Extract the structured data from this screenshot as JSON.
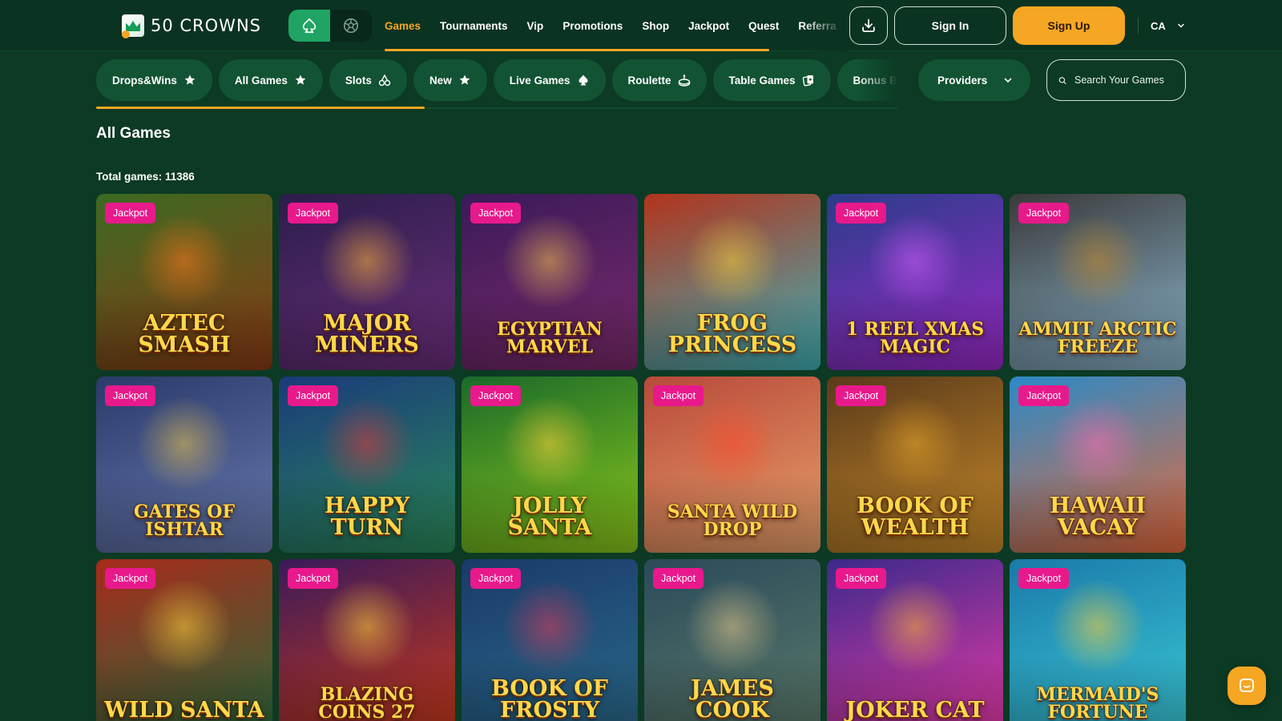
{
  "header": {
    "logo_text": "50 CROWNS",
    "nav": [
      {
        "label": "Games",
        "active": true
      },
      {
        "label": "Tournaments",
        "active": false
      },
      {
        "label": "Vip",
        "active": false
      },
      {
        "label": "Promotions",
        "active": false
      },
      {
        "label": "Shop",
        "active": false
      },
      {
        "label": "Jackpot",
        "active": false
      },
      {
        "label": "Quest",
        "active": false
      },
      {
        "label": "Referra",
        "active": false
      }
    ],
    "signin_label": "Sign In",
    "signup_label": "Sign Up",
    "language": "CA",
    "icons": {
      "casino_mode": "spade-icon",
      "sports_mode": "soccer-ball-icon",
      "download": "download-icon",
      "lang_caret": "chevron-down-icon"
    }
  },
  "categories": {
    "items": [
      {
        "label": "Drops&Wins",
        "icon": "star-icon"
      },
      {
        "label": "All Games",
        "icon": "star-icon"
      },
      {
        "label": "Slots",
        "icon": "cherries-icon"
      },
      {
        "label": "New",
        "icon": "star-icon"
      },
      {
        "label": "Live Games",
        "icon": "spade-icon"
      },
      {
        "label": "Roulette",
        "icon": "roulette-icon"
      },
      {
        "label": "Table Games",
        "icon": "cards-icon"
      },
      {
        "label": "Bonus Buy",
        "icon": ""
      }
    ],
    "providers_label": "Providers",
    "search_placeholder": "Search Your Games"
  },
  "content": {
    "section_title": "All Games",
    "total_games": "Total games: 11386",
    "badge_label": "Jackpot",
    "games": [
      {
        "title": "Aztec Smash",
        "badge": true,
        "bg": [
          "#3c6a22",
          "#8a3b14"
        ],
        "accent": "#ff7a1a"
      },
      {
        "title": "Major Miners",
        "badge": true,
        "bg": [
          "#2b1d4a",
          "#6b2f7a"
        ],
        "accent": "#ffb43a"
      },
      {
        "title": "Egyptian Marvel",
        "badge": true,
        "bg": [
          "#3a1a5a",
          "#7a2a6a"
        ],
        "accent": "#f2c14e"
      },
      {
        "title": "Frog Princess",
        "badge": false,
        "bg": [
          "#b2341c",
          "#3fb2b8"
        ],
        "accent": "#f7d03a"
      },
      {
        "title": "1 Reel Xmas Magic",
        "badge": true,
        "bg": [
          "#2a3c8a",
          "#9a2ac8"
        ],
        "accent": "#d25cff"
      },
      {
        "title": "Ammit Arctic Freeze",
        "badge": true,
        "bg": [
          "#3a3a3a",
          "#8ab4cc"
        ],
        "accent": "#c88a2a"
      },
      {
        "title": "Gates of Ishtar",
        "badge": true,
        "bg": [
          "#2a3a6a",
          "#6a7ab0"
        ],
        "accent": "#e8c24a"
      },
      {
        "title": "Happy Turn",
        "badge": true,
        "bg": [
          "#1a3a7a",
          "#2a8a5a"
        ],
        "accent": "#e03a3a"
      },
      {
        "title": "Jolly Santa",
        "badge": true,
        "bg": [
          "#1a6a2a",
          "#8ac81a"
        ],
        "accent": "#ffd23a"
      },
      {
        "title": "Santa Wild Drop",
        "badge": true,
        "bg": [
          "#b84a3a",
          "#e8a06a"
        ],
        "accent": "#ff4a2a"
      },
      {
        "title": "Book of Wealth",
        "badge": true,
        "bg": [
          "#5a3a1a",
          "#c88a2a"
        ],
        "accent": "#e8a62a"
      },
      {
        "title": "Hawaii Vacay",
        "badge": true,
        "bg": [
          "#2a8ac8",
          "#e86a3a"
        ],
        "accent": "#ff6ab0"
      },
      {
        "title": "Wild Santa",
        "badge": true,
        "bg": [
          "#a82a1a",
          "#2a6a3a"
        ],
        "accent": "#ffd23a"
      },
      {
        "title": "Blazing Coins 27",
        "badge": true,
        "bg": [
          "#3a1a5a",
          "#c8381a"
        ],
        "accent": "#ffd23a"
      },
      {
        "title": "Book of Frosty",
        "badge": true,
        "bg": [
          "#1a3a6a",
          "#2a6a8a"
        ],
        "accent": "#e03a5a"
      },
      {
        "title": "James Cook",
        "badge": true,
        "bg": [
          "#2a4a5a",
          "#5a7a6a"
        ],
        "accent": "#e8c88a"
      },
      {
        "title": "Joker Cat",
        "badge": true,
        "bg": [
          "#3a2a8a",
          "#e83aa8"
        ],
        "accent": "#ffb43a"
      },
      {
        "title": "Mermaid's Fortune",
        "badge": true,
        "bg": [
          "#1a7aa8",
          "#3ac8d8"
        ],
        "accent": "#ffd23a"
      }
    ]
  },
  "chat": {
    "icon": "chat-icon"
  },
  "colors": {
    "background": "#0c3a24",
    "header": "#0b3321",
    "pill": "#125334",
    "accent": "#f5a623",
    "badge": "#e8198b"
  }
}
